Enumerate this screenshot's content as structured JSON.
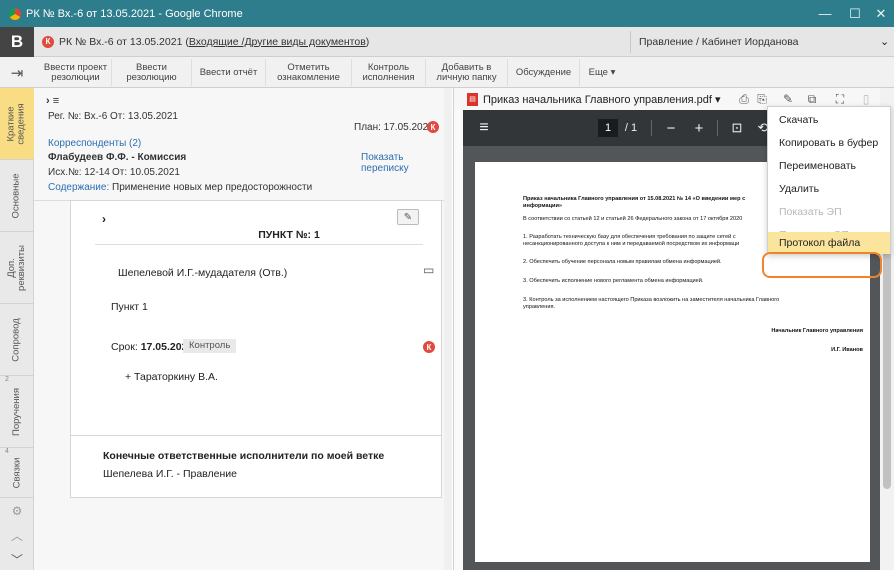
{
  "window": {
    "title": "РК № Вх.-6 от 13.05.2021 - Google Chrome"
  },
  "app": {
    "logo": "B",
    "badge": "К",
    "title_prefix": "РК № Вх.-6 от 13.05.2021 (",
    "title_link": "Входящие /Другие виды документов",
    "title_suffix": ")",
    "cabinet": "Правление / Кабинет Иорданова"
  },
  "toolbar": {
    "buttons": [
      "Ввести проект\nрезолюции",
      "Ввести\nрезолюцию",
      "Ввести отчёт",
      "Отметить\nознакомление",
      "Контроль\nисполнения",
      "Добавить в\nличную папку",
      "Обсуждение",
      "Еще ▾"
    ]
  },
  "sidebar": {
    "tabs": [
      "Краткие\nсведения",
      "Основные",
      "Доп.\nреквизиты",
      "Сопровод",
      "Поручения",
      "Связки"
    ],
    "tab_badge": "2",
    "tab_badge2": "4"
  },
  "left": {
    "head": "› ≡",
    "reg": "Рег. №: Вх.-6",
    "from": "От: 13.05.2021",
    "plan": "План: 17.05.2021",
    "correspondents": "Корреспонденты (2)",
    "show_chat": "Показать переписку",
    "sender": "Флабудеев Ф.Ф. - Комиссия",
    "outgoing_no": "Исх.№: 12-14",
    "outgoing_from": "От: 10.05.2021",
    "content_label": "Содержание:",
    "content": " Применение новых мер предосторожности",
    "card_chev": "›",
    "point_title": "ПУНКТ №: 1",
    "executor": "Шепелевой И.Г.-мудадателя  (Отв.)",
    "point_text": "Пункт 1",
    "deadline_label": "Срок:",
    "deadline": "17.05.2021",
    "control_tag": "Контроль",
    "extra_exec": "+ Тараторкину В.А.",
    "final_title": "Конечные ответственные исполнители по моей ветке",
    "final_exec": "Шепелева И.Г. - Правление"
  },
  "pdf": {
    "filename": "Приказ начальника Главного управления.pdf ▾",
    "page_current": "1",
    "page_total": "/ 1",
    "doc_title": "Приказ начальника Главного управления от 15.08.2021 № 14 «О введении мер с",
    "doc_title2": "информации»",
    "p1": "В соответствии со статьей 12 и статьей 26 Федерального закона от 17 октября 2020",
    "p2": "1. Разработать техническую базу для обеспечения требования по защите сетей с",
    "p2b": "несанкционированного доступа к ним и передаваемой посредством их информаци",
    "p3": "2. Обеспечить обучение персонала новым правилам обмена информацией.",
    "p4": "3. Обеспечить исполнение нового регламента обмена информацией.",
    "p5": "3. Контроль за исполнением настоящего Приказа возложить на заместителя начальника Главного",
    "p5b": "управления.",
    "sign_role": "Начальник Главного управления",
    "sign_name": "И.Г. Иванов"
  },
  "menu": {
    "items": [
      "Скачать",
      "Копировать в буфер",
      "Переименовать",
      "Удалить",
      "Показать ЭП",
      "Подписать ЭП",
      "Протокол файла"
    ]
  },
  "colors": {
    "titlebar": "#2e7d8c",
    "active_tab": "#f9dd84",
    "menu_highlight": "#fbe49b",
    "ring": "#f0842a",
    "badge_red": "#e04a3f"
  }
}
